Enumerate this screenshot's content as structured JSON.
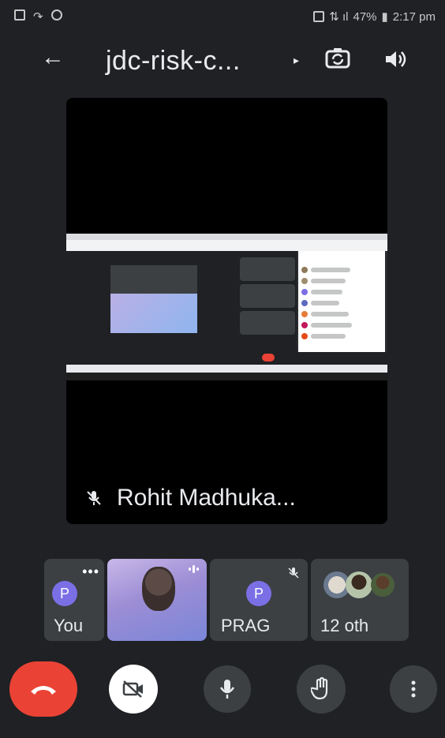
{
  "status_bar": {
    "battery": "47%",
    "time": "2:17 pm"
  },
  "header": {
    "title": "jdc-risk-c...",
    "back_icon": "arrow-left-icon",
    "switch_camera_icon": "switch-camera-icon",
    "speaker_icon": "speaker-icon"
  },
  "main_view": {
    "presenter_name": "Rohit Madhuka..."
  },
  "participants": [
    {
      "label": "You",
      "avatar": "P"
    },
    {
      "label": "",
      "avatar": ""
    },
    {
      "label": "PRAG",
      "avatar": "P"
    },
    {
      "label": "12 oth",
      "avatar": ""
    }
  ],
  "controls": {
    "end_call_icon": "end-call-icon",
    "camera_off_icon": "camera-off-icon",
    "mic_icon": "mic-icon",
    "raise_hand_icon": "raise-hand-icon",
    "more_icon": "more-vert-icon"
  },
  "colors": {
    "end_call": "#ea4335",
    "avatar": "#7b6fe6",
    "background": "#202124"
  }
}
